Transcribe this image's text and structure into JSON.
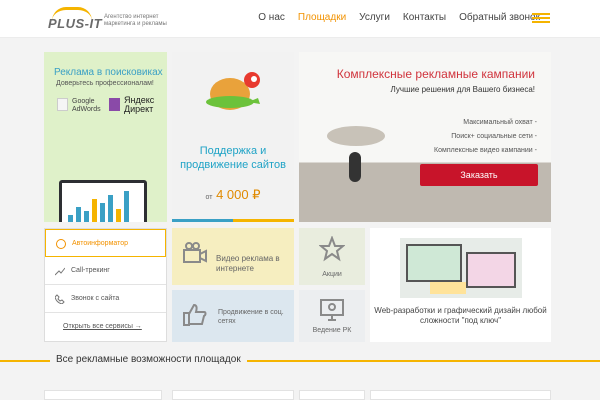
{
  "header": {
    "logo_text": "PLUS-IT",
    "tagline": "Агентство интернет маркетинга и рекламы",
    "nav": [
      "О нас",
      "Площадки",
      "Услуги",
      "Контакты",
      "Обратный звонок"
    ],
    "active_index": 1
  },
  "cards": {
    "search_ads": {
      "title": "Реклама в поисковиках",
      "subtitle": "Доверьтесь профессионалам!",
      "google": "Google AdWords",
      "yandex": "Яндекс Директ"
    },
    "seo": {
      "title": "Поддержка и продвижение сайтов",
      "price_prefix": "от",
      "price": "4 000 ₽"
    },
    "campaigns": {
      "title": "Комплексные рекламные кампании",
      "subtitle": "Лучшие решения для Вашего бизнеса!",
      "items": [
        "Максимальный охват -",
        "Поиск+ социальные сети -",
        "Комплексные видео кампании -"
      ],
      "button": "Заказать"
    },
    "video": {
      "label": "Видео реклама в интернете"
    },
    "promo": {
      "label": "Акции"
    },
    "social": {
      "label": "Продвижение в соц. сетях"
    },
    "pk": {
      "label": "Ведение РК"
    },
    "web": {
      "label": "Web-разработки и графический дизайн любой сложности \"под ключ\""
    }
  },
  "services": {
    "items": [
      "Автоинформатор",
      "Call-трекинг",
      "Звонок с сайта"
    ],
    "link": "Открыть все сервисы →"
  },
  "section_title": "Все рекламные возможности площадок",
  "colors": {
    "accent": "#f5b400",
    "active_nav": "#f29200",
    "cta": "#c8142a",
    "seo_text": "#1fa3c6"
  }
}
